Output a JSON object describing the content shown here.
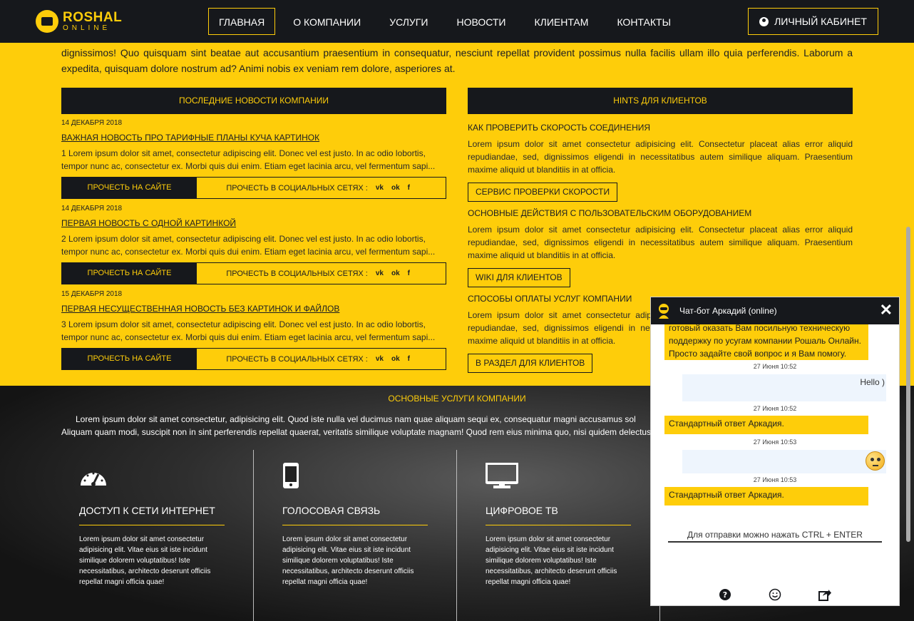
{
  "header": {
    "logo_line1": "ROSHAL",
    "logo_line2": "ONLINE",
    "nav": [
      "ГЛАВНАЯ",
      "О КОМПАНИИ",
      "УСЛУГИ",
      "НОВОСТИ",
      "КЛИЕНТАМ",
      "КОНТАКТЫ"
    ],
    "active_nav": "ГЛАВНАЯ",
    "cabinet_label": "ЛИЧНЫЙ КАБИНЕТ"
  },
  "intro_text": "dignissimos! Quo quisquam sint beatae aut accusantium praesentium in consequatur, nesciunt repellat provident possimus nulla facilis ullam illo quia perferendis. Laborum a expedita, quisquam dolore nostrum ad? Animi nobis ex veniam rem dolore, asperiores at.",
  "news": {
    "heading": "ПОСЛЕДНИЕ НОВОСТИ КОМПАНИИ",
    "read_label": "ПРОЧЕСТЬ НА САЙТЕ",
    "social_label": "ПРОЧЕСТЬ В СОЦИАЛЬНЫХ СЕТЯХ :",
    "social_icons": [
      "vk-icon",
      "ok-icon",
      "facebook-icon"
    ],
    "items": [
      {
        "date": "14 ДЕКАБРЯ 2018",
        "title": "ВАЖНАЯ НОВОСТЬ ПРО ТАРИФНЫЕ ПЛАНЫ КУЧА КАРТИНОК",
        "line1": "1 Lorem ipsum dolor sit amet, consectetur adipiscing elit. Donec vel est justo. In ac odio lobortis,",
        "line2": "tempor nunc ac, consectetur ex. Morbi quis dui enim. Etiam eget lacinia arcu, vel fermentum sapi..."
      },
      {
        "date": "14 ДЕКАБРЯ 2018",
        "title": "ПЕРВАЯ НОВОСТЬ С ОДНОЙ КАРТИНКОЙ",
        "line1": "2 Lorem ipsum dolor sit amet, consectetur adipiscing elit. Donec vel est justo. In ac odio lobortis,",
        "line2": "tempor nunc ac, consectetur ex. Morbi quis dui enim. Etiam eget lacinia arcu, vel fermentum sapi..."
      },
      {
        "date": "15 ДЕКАБРЯ 2018",
        "title": "ПЕРВАЯ НЕСУЩЕСТВЕННАЯ НОВОСТЬ БЕЗ КАРТИНОК И ФАЙЛОВ",
        "line1": "3 Lorem ipsum dolor sit amet, consectetur adipiscing elit. Donec vel est justo. In ac odio lobortis,",
        "line2": "tempor nunc ac, consectetur ex. Morbi quis dui enim. Etiam eget lacinia arcu, vel fermentum sapi..."
      }
    ]
  },
  "hints": {
    "heading": "HINTS ДЛЯ КЛИЕНТОВ",
    "items": [
      {
        "title": "КАК ПРОВЕРИТЬ СКОРОСТЬ СОЕДИНЕНИЯ",
        "text": "Lorem ipsum dolor sit amet consectetur adipisicing elit. Consectetur placeat alias error aliquid repudiandae, sed, dignissimos eligendi in necessitatibus autem similique aliquam. Praesentium maxime aliquid ut blanditiis in at officia.",
        "button": "СЕРВИС ПРОВЕРКИ СКОРОСТИ"
      },
      {
        "title": "ОСНОВНЫЕ ДЕЙСТВИЯ С ПОЛЬЗОВАТЕЛЬСКИМ ОБОРУДОВАНИЕМ",
        "text": "Lorem ipsum dolor sit amet consectetur adipisicing elit. Consectetur placeat alias error aliquid repudiandae, sed, dignissimos eligendi in necessitatibus autem similique aliquam. Praesentium maxime aliquid ut blanditiis in at officia.",
        "button": "WIKI ДЛЯ КЛИЕНТОВ"
      },
      {
        "title": "СПОСОБЫ ОПЛАТЫ УСЛУГ КОМПАНИИ",
        "text": "Lorem ipsum dolor sit amet consectetur adipisicing elit. Consectetur placeat alias error aliquid repudiandae, sed, dignissimos eligendi in necessitatibus autem similique aliquam. Praesentium maxime aliquid ut blanditiis in at officia.",
        "button": "В РАЗДЕЛ ДЛЯ КЛИЕНТОВ"
      }
    ]
  },
  "services": {
    "heading": "ОСНОВНЫЕ УСЛУГИ КОМПАНИИ",
    "text_line1": "Lorem ipsum dolor sit amet consectetur, adipisicing elit. Quod iste nulla vel ducimus nam quae aliquam sequi ex, consequatur magni accusamus sol",
    "text_line2": "Aliquam quam modi, suscipit non in sint perferendis repellat quaerat, veritatis similique voluptate magnam! Quod rem eius minima quo, nisi quidem delectus labo",
    "items": [
      {
        "icon": "speedometer-icon",
        "title": "ДОСТУП К СЕТИ ИНТЕРНЕТ",
        "text": "Lorem ipsum dolor sit amet consectetur adipisicing elit. Vitae eius sit iste incidunt similique dolorem voluptatibus! Iste necessitatibus, architecto deserunt officiis repellat magni officia quae!"
      },
      {
        "icon": "phone-icon",
        "title": "ГОЛОСОВАЯ СВЯЗЬ",
        "text": "Lorem ipsum dolor sit amet consectetur adipisicing elit. Vitae eius sit iste incidunt similique dolorem voluptatibus! Iste necessitatibus, architecto deserunt officiis repellat magni officia quae!"
      },
      {
        "icon": "monitor-icon",
        "title": "ЦИФРОВОЕ ТВ",
        "text": "Lorem ipsum dolor sit amet consectetur adipisicing elit. Vitae eius sit iste incidunt similique dolorem voluptatibus! Iste necessitatibus, architecto deserunt officiis repellat magni officia quae!"
      }
    ]
  },
  "chat": {
    "title": "Чат-бот Аркадий (online)",
    "close": "✕",
    "greeting_line1": "готовый оказать Вам посильную техническую",
    "greeting_line2": "поддержку по усугам компании Рошаль Онлайн.",
    "greeting_line3": "Просто задайте свой вопрос и я Вам помогу.",
    "time1": "27 Июня 10:52",
    "user_msg1": "Hello )",
    "time2": "27 Июня 10:52",
    "bot_reply1": "Стандартный ответ Аркадия.",
    "time3": "27 Июня 10:53",
    "time4": "27 Июня 10:53",
    "bot_reply2": "Стандартный ответ Аркадия.",
    "input_placeholder": "Для отправки можно нажать CTRL + ENTER",
    "footer_icons": [
      "help-icon",
      "smile-icon",
      "share-icon"
    ]
  },
  "colors": {
    "accent": "#fecd0a",
    "dark": "#16181c",
    "user_bubble": "#eef5fd"
  }
}
